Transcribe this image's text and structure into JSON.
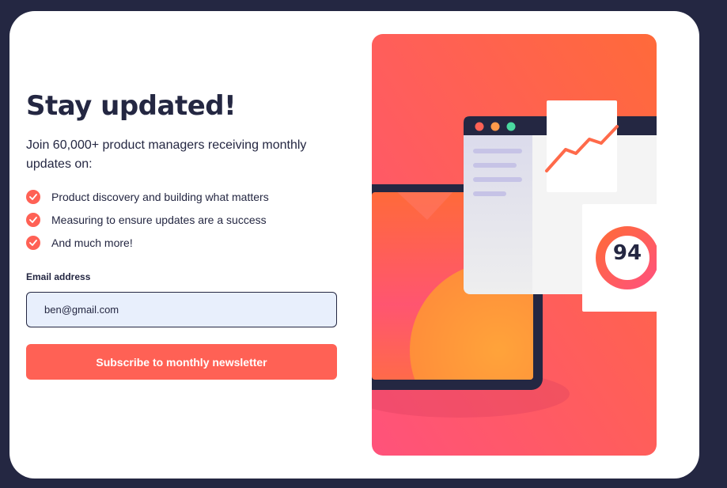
{
  "signup": {
    "title": "Stay updated!",
    "subtitle": "Join 60,000+ product managers receiving monthly updates on:",
    "features": [
      "Product discovery and building what matters",
      "Measuring to ensure updates are a success",
      "And much more!"
    ],
    "email_label": "Email address",
    "email_value": "ben@gmail.com",
    "subscribe_label": "Subscribe to monthly newsletter"
  },
  "illustration": {
    "score": "94"
  },
  "colors": {
    "background": "#242742",
    "accent": "#ff6155",
    "text": "#242742",
    "input_bg": "#e8effc"
  }
}
